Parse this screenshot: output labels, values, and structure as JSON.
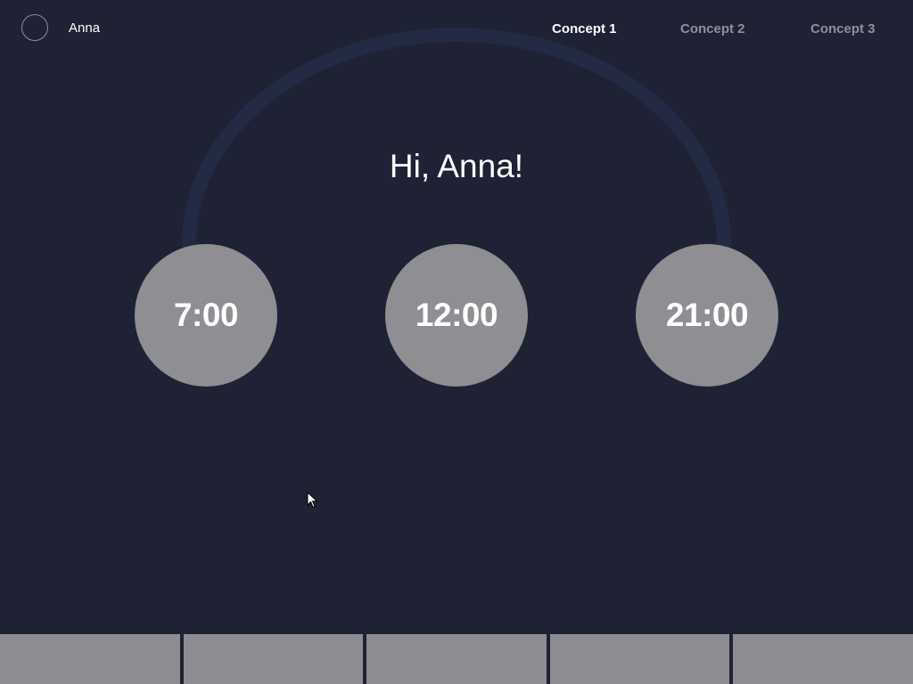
{
  "user": {
    "name": "Anna",
    "avatar_icon": "avatar-circle-icon"
  },
  "tabs": [
    {
      "label": "Concept 1",
      "active": true
    },
    {
      "label": "Concept 2",
      "active": false
    },
    {
      "label": "Concept 3",
      "active": false
    }
  ],
  "greeting": "Hi, Anna!",
  "times": [
    {
      "label": "7:00"
    },
    {
      "label": "12:00"
    },
    {
      "label": "21:00"
    }
  ],
  "bottom_bar": {
    "item_count": 5
  },
  "colors": {
    "background": "#1f2234",
    "circle": "#8e8e93",
    "arc": "#222a44",
    "tab_inactive": "#8e909b",
    "tab_active": "#ffffff",
    "bottom_bar": "#8c8c92"
  }
}
